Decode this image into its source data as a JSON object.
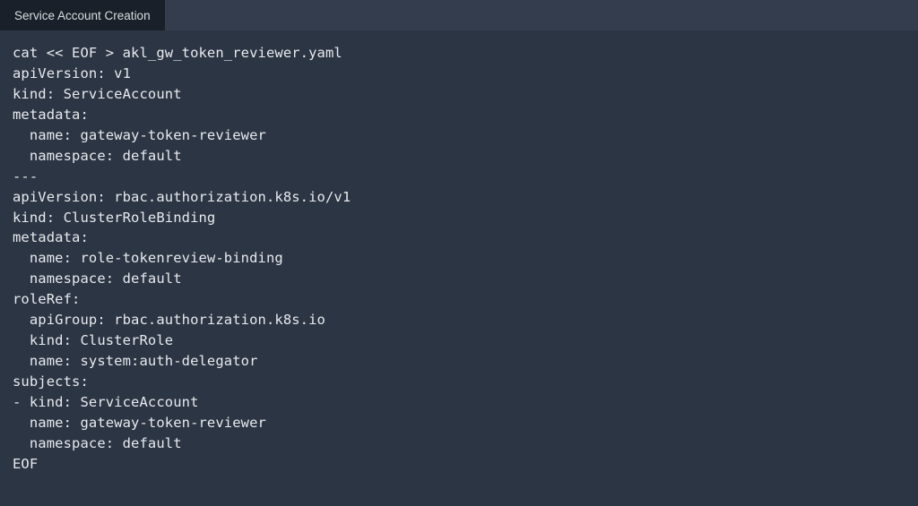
{
  "tabs": [
    {
      "label": "Service Account Creation"
    }
  ],
  "code_lines": [
    "cat << EOF > akl_gw_token_reviewer.yaml",
    "apiVersion: v1",
    "kind: ServiceAccount",
    "metadata:",
    "  name: gateway-token-reviewer",
    "  namespace: default",
    "---",
    "apiVersion: rbac.authorization.k8s.io/v1",
    "kind: ClusterRoleBinding",
    "metadata:",
    "  name: role-tokenreview-binding",
    "  namespace: default",
    "roleRef:",
    "  apiGroup: rbac.authorization.k8s.io",
    "  kind: ClusterRole",
    "  name: system:auth-delegator",
    "subjects:",
    "- kind: ServiceAccount",
    "  name: gateway-token-reviewer",
    "  namespace: default",
    "EOF"
  ]
}
